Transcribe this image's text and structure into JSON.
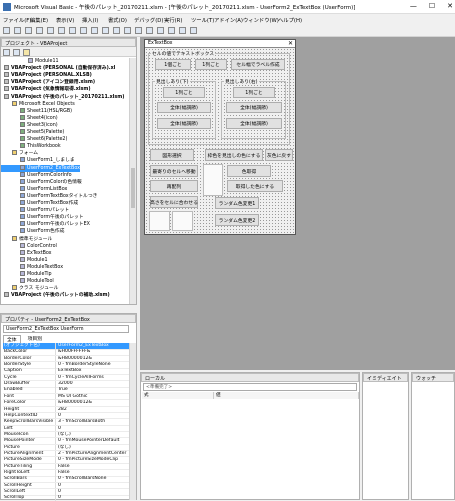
{
  "window": {
    "title": "Microsoft Visual Basic - 午後のパレット_20170211.xlsm - [午後のパレット_20170211.xlsm - UserForm2_ExTextBox (UserForm)]",
    "minimize": "—",
    "maximize": "☐",
    "close": "✕"
  },
  "menu": [
    "ファイル(F)",
    "編集(E)",
    "表示(V)",
    "挿入(I)",
    "書式(O)",
    "デバッグ(D)",
    "実行(R)",
    "ツール(T)",
    "アドイン(A)",
    "ウィンドウ(W)",
    "ヘルプ(H)"
  ],
  "project": {
    "title": "プロジェクト - VBAProject",
    "items": [
      {
        "text": "Module11",
        "indent": 3,
        "bold": false,
        "icon": "module"
      },
      {
        "text": "VBAProject (PERSONAL (自動保存済み).xl",
        "indent": 0,
        "bold": true,
        "icon": "project"
      },
      {
        "text": "VBAProject (PERSONAL.XLSB)",
        "indent": 0,
        "bold": true,
        "icon": "project"
      },
      {
        "text": "VBAProject (アイコン登録用.xlsm)",
        "indent": 0,
        "bold": true,
        "icon": "project"
      },
      {
        "text": "VBAProject (気象情報取得.xlsm)",
        "indent": 0,
        "bold": true,
        "icon": "project"
      },
      {
        "text": "VBAProject (午後のパレット_20170211.xlsm)",
        "indent": 0,
        "bold": true,
        "icon": "project"
      },
      {
        "text": "Microsoft Excel Objects",
        "indent": 1,
        "bold": false,
        "icon": "folder"
      },
      {
        "text": "Sheet11(HSL/RGB)",
        "indent": 2,
        "bold": false,
        "icon": "sheet"
      },
      {
        "text": "Sheet4(icon)",
        "indent": 2,
        "bold": false,
        "icon": "sheet"
      },
      {
        "text": "Sheet3(icon)",
        "indent": 2,
        "bold": false,
        "icon": "sheet"
      },
      {
        "text": "Sheet5(Palette)",
        "indent": 2,
        "bold": false,
        "icon": "sheet"
      },
      {
        "text": "Sheet6(Palette2)",
        "indent": 2,
        "bold": false,
        "icon": "sheet"
      },
      {
        "text": "ThisWorkbook",
        "indent": 2,
        "bold": false,
        "icon": "sheet"
      },
      {
        "text": "フォーム",
        "indent": 1,
        "bold": false,
        "icon": "folder"
      },
      {
        "text": "UserForm1_しましま",
        "indent": 2,
        "bold": false,
        "icon": "form"
      },
      {
        "text": "UserForm2_ExTextBox",
        "indent": 2,
        "bold": false,
        "icon": "form",
        "selected": true
      },
      {
        "text": "UserFormColorInfo",
        "indent": 2,
        "bold": false,
        "icon": "form"
      },
      {
        "text": "UserFormColorの色情報",
        "indent": 2,
        "bold": false,
        "icon": "form"
      },
      {
        "text": "UserFormListBox",
        "indent": 2,
        "bold": false,
        "icon": "form"
      },
      {
        "text": "UserFormTextBoxタイトルつき",
        "indent": 2,
        "bold": false,
        "icon": "form"
      },
      {
        "text": "UserFormTextBox作成",
        "indent": 2,
        "bold": false,
        "icon": "form"
      },
      {
        "text": "UserFormパレット",
        "indent": 2,
        "bold": false,
        "icon": "form"
      },
      {
        "text": "UserForm午後のパレット",
        "indent": 2,
        "bold": false,
        "icon": "form"
      },
      {
        "text": "UserForm午後のパレットEX",
        "indent": 2,
        "bold": false,
        "icon": "form"
      },
      {
        "text": "UserForm色作成",
        "indent": 2,
        "bold": false,
        "icon": "form"
      },
      {
        "text": "標準モジュール",
        "indent": 1,
        "bold": false,
        "icon": "folder"
      },
      {
        "text": "ColorControl",
        "indent": 2,
        "bold": false,
        "icon": "module"
      },
      {
        "text": "ExTextBox",
        "indent": 2,
        "bold": false,
        "icon": "module"
      },
      {
        "text": "Module1",
        "indent": 2,
        "bold": false,
        "icon": "module"
      },
      {
        "text": "ModuleTextBox",
        "indent": 2,
        "bold": false,
        "icon": "module"
      },
      {
        "text": "ModuleTip",
        "indent": 2,
        "bold": false,
        "icon": "module"
      },
      {
        "text": "ModuleTool",
        "indent": 2,
        "bold": false,
        "icon": "module"
      },
      {
        "text": "クラス モジュール",
        "indent": 1,
        "bold": false,
        "icon": "folder"
      },
      {
        "text": "VBAProject (午後のパレットの補助.xlsm)",
        "indent": 0,
        "bold": true,
        "icon": "project"
      }
    ]
  },
  "properties": {
    "title": "プロパティ - UserForm2_ExTextBox",
    "object": "UserForm2_ExTextBox UserForm",
    "tab_all": "全体",
    "tab_cat": "項目別",
    "rows": [
      {
        "k": "(オブジェクト名)",
        "v": "UserForm2_ExTextBox",
        "sel": true
      },
      {
        "k": "BackColor",
        "v": "&H00FFFFFF&"
      },
      {
        "k": "BorderColor",
        "v": "&H80000012&"
      },
      {
        "k": "BorderStyle",
        "v": "0 - fmBorderStyleNone"
      },
      {
        "k": "Caption",
        "v": "ExTextBox"
      },
      {
        "k": "Cycle",
        "v": "0 - fmCycleAllForms"
      },
      {
        "k": "DrawBuffer",
        "v": "32000"
      },
      {
        "k": "Enabled",
        "v": "True"
      },
      {
        "k": "Font",
        "v": "MS UI Gothic"
      },
      {
        "k": "ForeColor",
        "v": "&H80000012&"
      },
      {
        "k": "Height",
        "v": "282"
      },
      {
        "k": "HelpContextID",
        "v": "0"
      },
      {
        "k": "KeepScrollBarsVisible",
        "v": "3 - fmScrollBarsBoth"
      },
      {
        "k": "Left",
        "v": "0"
      },
      {
        "k": "MouseIcon",
        "v": "(なし)"
      },
      {
        "k": "MousePointer",
        "v": "0 - fmMousePointerDefault"
      },
      {
        "k": "Picture",
        "v": "(なし)"
      },
      {
        "k": "PictureAlignment",
        "v": "2 - fmPictureAlignmentCenter"
      },
      {
        "k": "PictureSizeMode",
        "v": "0 - fmPictureSizeModeClip"
      },
      {
        "k": "PictureTiling",
        "v": "False"
      },
      {
        "k": "RightToLeft",
        "v": "False"
      },
      {
        "k": "ScrollBars",
        "v": "0 - fmScrollBarsNone"
      },
      {
        "k": "ScrollHeight",
        "v": "0"
      },
      {
        "k": "ScrollLeft",
        "v": "0"
      },
      {
        "k": "ScrollTop",
        "v": "0"
      }
    ]
  },
  "form": {
    "title": "ExTextBox",
    "close": "✕",
    "group_main": "セルの値でテキストボックス",
    "btn_1ko": "1個ごと",
    "btn_1retsu": "1列ごと",
    "btn_cellcap": "セル幅でラベル作成",
    "group_left": "見出しあり(下)",
    "group_right": "見出しあり(右)",
    "btn_1ko_l": "1列ごと",
    "btn_1ko_r": "1列ごと",
    "btn_all1_l": "全体(幅調節)",
    "btn_all1_r": "全体(幅調節)",
    "btn_all2_l": "全体(幅調節)",
    "btn_all2_r": "全体(幅調節)",
    "btn_shape": "図形選択",
    "btn_colorset": "枠色を見出しの色にする",
    "btn_bgcolor": "灰色に戻す",
    "btn_move": "最寄りのセルへ移動",
    "btn_coloruse": "色取得",
    "btn_arrange": "再配列",
    "btn_autocolor": "取得した色にする",
    "btn_align": "高さをセルに合わせる",
    "btn_random": "ランダム色変更1",
    "btn_random2": "ランダム色変更2"
  },
  "locals": {
    "title": "ローカル",
    "placeholder": "<準備完了>",
    "col_expr": "式",
    "col_val": "値"
  },
  "watch": {
    "title1": "イミディエイト",
    "title2": "ウォッチ"
  }
}
